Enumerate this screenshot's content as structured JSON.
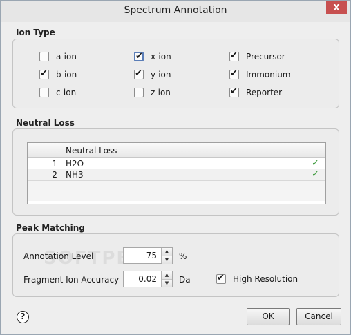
{
  "window": {
    "title": "Spectrum Annotation",
    "close_label": "X"
  },
  "ion_type": {
    "label": "Ion Type",
    "items": [
      {
        "label": "a-ion",
        "checked": false
      },
      {
        "label": "x-ion",
        "checked": true,
        "focused": true
      },
      {
        "label": "Precursor",
        "checked": true
      },
      {
        "label": "b-ion",
        "checked": true
      },
      {
        "label": "y-ion",
        "checked": true
      },
      {
        "label": "Immonium",
        "checked": true
      },
      {
        "label": "c-ion",
        "checked": false
      },
      {
        "label": "z-ion",
        "checked": false
      },
      {
        "label": "Reporter",
        "checked": true
      }
    ]
  },
  "neutral_loss": {
    "label": "Neutral Loss",
    "header": {
      "name": "Neutral Loss"
    },
    "rows": [
      {
        "index": "1",
        "name": "H2O",
        "check": "✓"
      },
      {
        "index": "2",
        "name": "NH3",
        "check": "✓"
      }
    ]
  },
  "peak_matching": {
    "label": "Peak Matching",
    "annotation_level_label": "Annotation Level",
    "annotation_level_value": "75",
    "annotation_level_unit": "%",
    "fragment_accuracy_label": "Fragment Ion Accuracy",
    "fragment_accuracy_value": "0.02",
    "fragment_accuracy_unit": "Da",
    "high_resolution_label": "High Resolution",
    "high_resolution_checked": true
  },
  "footer": {
    "help_label": "?",
    "ok_label": "OK",
    "cancel_label": "Cancel"
  },
  "watermark": "SOFTPEDIA"
}
